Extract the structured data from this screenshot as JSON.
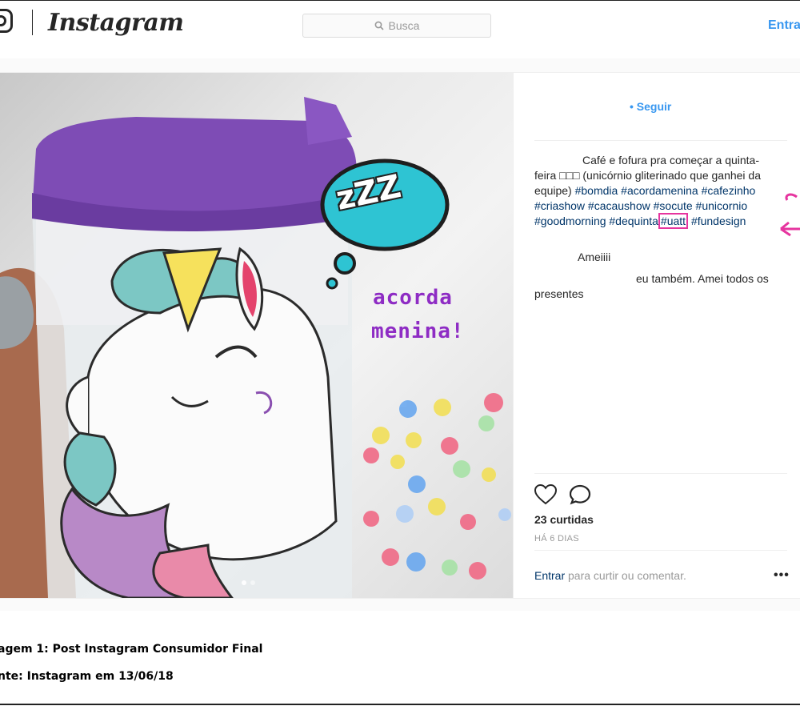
{
  "header": {
    "brand": "Instagram",
    "search_placeholder": "Busca",
    "login_label": "Entrar"
  },
  "photo": {
    "overlay_zzz": "zZZ",
    "overlay_line1": "acorda",
    "overlay_line2": "menina!"
  },
  "post": {
    "follow_label": "• Seguir",
    "caption_lead": "Café e fofura pra começar a quinta-feira",
    "caption_emoji": "□□□",
    "caption_text": "(unicórnio gliterinado que ganhei da equipe)",
    "caption_tags": "#bomdia #acordamenina #cafezinho #criashow #cacaushow #socute #unicornio #goodmorning #dequinta",
    "caption_highlight_tag": "#uatt",
    "caption_last_tag": "#fundesign",
    "comment_1": "Ameiiii",
    "comment_2": "eu também. Amei todos os presentes",
    "likes": "23 curtidas",
    "time": "HÁ 6 DIAS",
    "login_link": "Entrar",
    "login_suffix": " para curtir ou comentar.",
    "more_label": "•••"
  },
  "figure": {
    "caption_1": "agem 1: Post Instagram Consumidor Final",
    "caption_2": "nte: Instagram em 13/06/18"
  },
  "colors": {
    "accent_blue": "#3897f0",
    "highlight_pink": "#e6359f",
    "lid_purple": "#7e4cb5"
  }
}
